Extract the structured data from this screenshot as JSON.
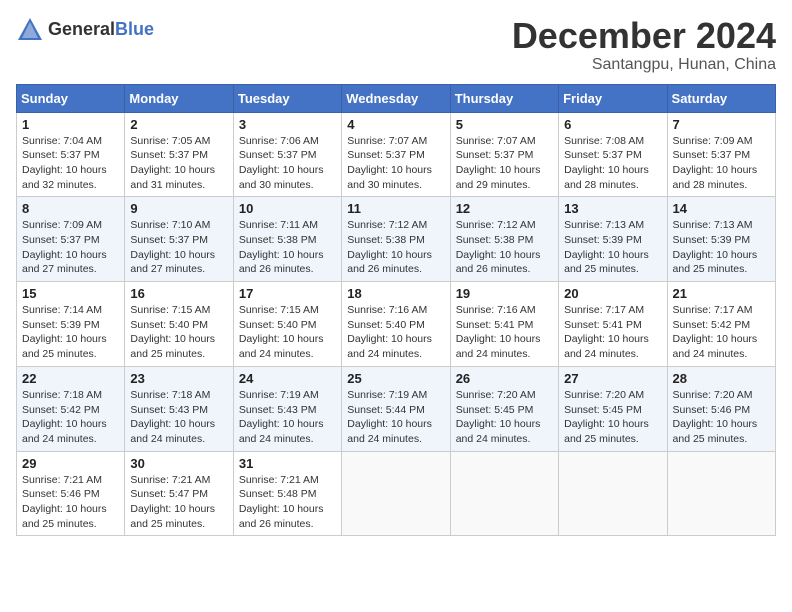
{
  "logo": {
    "general": "General",
    "blue": "Blue"
  },
  "header": {
    "month": "December 2024",
    "location": "Santangpu, Hunan, China"
  },
  "weekdays": [
    "Sunday",
    "Monday",
    "Tuesday",
    "Wednesday",
    "Thursday",
    "Friday",
    "Saturday"
  ],
  "weeks": [
    [
      {
        "day": "1",
        "info": "Sunrise: 7:04 AM\nSunset: 5:37 PM\nDaylight: 10 hours\nand 32 minutes."
      },
      {
        "day": "2",
        "info": "Sunrise: 7:05 AM\nSunset: 5:37 PM\nDaylight: 10 hours\nand 31 minutes."
      },
      {
        "day": "3",
        "info": "Sunrise: 7:06 AM\nSunset: 5:37 PM\nDaylight: 10 hours\nand 30 minutes."
      },
      {
        "day": "4",
        "info": "Sunrise: 7:07 AM\nSunset: 5:37 PM\nDaylight: 10 hours\nand 30 minutes."
      },
      {
        "day": "5",
        "info": "Sunrise: 7:07 AM\nSunset: 5:37 PM\nDaylight: 10 hours\nand 29 minutes."
      },
      {
        "day": "6",
        "info": "Sunrise: 7:08 AM\nSunset: 5:37 PM\nDaylight: 10 hours\nand 28 minutes."
      },
      {
        "day": "7",
        "info": "Sunrise: 7:09 AM\nSunset: 5:37 PM\nDaylight: 10 hours\nand 28 minutes."
      }
    ],
    [
      {
        "day": "8",
        "info": "Sunrise: 7:09 AM\nSunset: 5:37 PM\nDaylight: 10 hours\nand 27 minutes."
      },
      {
        "day": "9",
        "info": "Sunrise: 7:10 AM\nSunset: 5:37 PM\nDaylight: 10 hours\nand 27 minutes."
      },
      {
        "day": "10",
        "info": "Sunrise: 7:11 AM\nSunset: 5:38 PM\nDaylight: 10 hours\nand 26 minutes."
      },
      {
        "day": "11",
        "info": "Sunrise: 7:12 AM\nSunset: 5:38 PM\nDaylight: 10 hours\nand 26 minutes."
      },
      {
        "day": "12",
        "info": "Sunrise: 7:12 AM\nSunset: 5:38 PM\nDaylight: 10 hours\nand 26 minutes."
      },
      {
        "day": "13",
        "info": "Sunrise: 7:13 AM\nSunset: 5:39 PM\nDaylight: 10 hours\nand 25 minutes."
      },
      {
        "day": "14",
        "info": "Sunrise: 7:13 AM\nSunset: 5:39 PM\nDaylight: 10 hours\nand 25 minutes."
      }
    ],
    [
      {
        "day": "15",
        "info": "Sunrise: 7:14 AM\nSunset: 5:39 PM\nDaylight: 10 hours\nand 25 minutes."
      },
      {
        "day": "16",
        "info": "Sunrise: 7:15 AM\nSunset: 5:40 PM\nDaylight: 10 hours\nand 25 minutes."
      },
      {
        "day": "17",
        "info": "Sunrise: 7:15 AM\nSunset: 5:40 PM\nDaylight: 10 hours\nand 24 minutes."
      },
      {
        "day": "18",
        "info": "Sunrise: 7:16 AM\nSunset: 5:40 PM\nDaylight: 10 hours\nand 24 minutes."
      },
      {
        "day": "19",
        "info": "Sunrise: 7:16 AM\nSunset: 5:41 PM\nDaylight: 10 hours\nand 24 minutes."
      },
      {
        "day": "20",
        "info": "Sunrise: 7:17 AM\nSunset: 5:41 PM\nDaylight: 10 hours\nand 24 minutes."
      },
      {
        "day": "21",
        "info": "Sunrise: 7:17 AM\nSunset: 5:42 PM\nDaylight: 10 hours\nand 24 minutes."
      }
    ],
    [
      {
        "day": "22",
        "info": "Sunrise: 7:18 AM\nSunset: 5:42 PM\nDaylight: 10 hours\nand 24 minutes."
      },
      {
        "day": "23",
        "info": "Sunrise: 7:18 AM\nSunset: 5:43 PM\nDaylight: 10 hours\nand 24 minutes."
      },
      {
        "day": "24",
        "info": "Sunrise: 7:19 AM\nSunset: 5:43 PM\nDaylight: 10 hours\nand 24 minutes."
      },
      {
        "day": "25",
        "info": "Sunrise: 7:19 AM\nSunset: 5:44 PM\nDaylight: 10 hours\nand 24 minutes."
      },
      {
        "day": "26",
        "info": "Sunrise: 7:20 AM\nSunset: 5:45 PM\nDaylight: 10 hours\nand 24 minutes."
      },
      {
        "day": "27",
        "info": "Sunrise: 7:20 AM\nSunset: 5:45 PM\nDaylight: 10 hours\nand 25 minutes."
      },
      {
        "day": "28",
        "info": "Sunrise: 7:20 AM\nSunset: 5:46 PM\nDaylight: 10 hours\nand 25 minutes."
      }
    ],
    [
      {
        "day": "29",
        "info": "Sunrise: 7:21 AM\nSunset: 5:46 PM\nDaylight: 10 hours\nand 25 minutes."
      },
      {
        "day": "30",
        "info": "Sunrise: 7:21 AM\nSunset: 5:47 PM\nDaylight: 10 hours\nand 25 minutes."
      },
      {
        "day": "31",
        "info": "Sunrise: 7:21 AM\nSunset: 5:48 PM\nDaylight: 10 hours\nand 26 minutes."
      },
      {
        "day": "",
        "info": ""
      },
      {
        "day": "",
        "info": ""
      },
      {
        "day": "",
        "info": ""
      },
      {
        "day": "",
        "info": ""
      }
    ]
  ]
}
